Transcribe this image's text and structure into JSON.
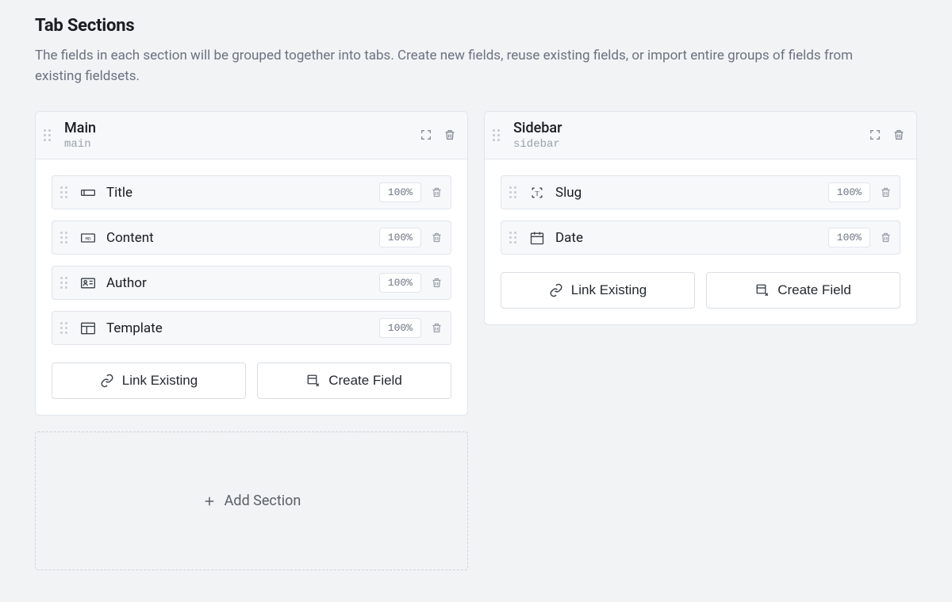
{
  "header": {
    "title": "Tab Sections",
    "description": "The fields in each section will be grouped together into tabs. Create new fields, reuse existing fields, or import entire groups of fields from existing fieldsets."
  },
  "buttons": {
    "link_existing": "Link Existing",
    "create_field": "Create Field",
    "add_section": "Add Section"
  },
  "sections": [
    {
      "title": "Main",
      "handle": "main",
      "fields": [
        {
          "icon": "text",
          "label": "Title",
          "width": "100%"
        },
        {
          "icon": "markdown",
          "label": "Content",
          "width": "100%"
        },
        {
          "icon": "user",
          "label": "Author",
          "width": "100%"
        },
        {
          "icon": "template",
          "label": "Template",
          "width": "100%"
        }
      ]
    },
    {
      "title": "Sidebar",
      "handle": "sidebar",
      "fields": [
        {
          "icon": "slug",
          "label": "Slug",
          "width": "100%"
        },
        {
          "icon": "date",
          "label": "Date",
          "width": "100%"
        }
      ]
    }
  ]
}
